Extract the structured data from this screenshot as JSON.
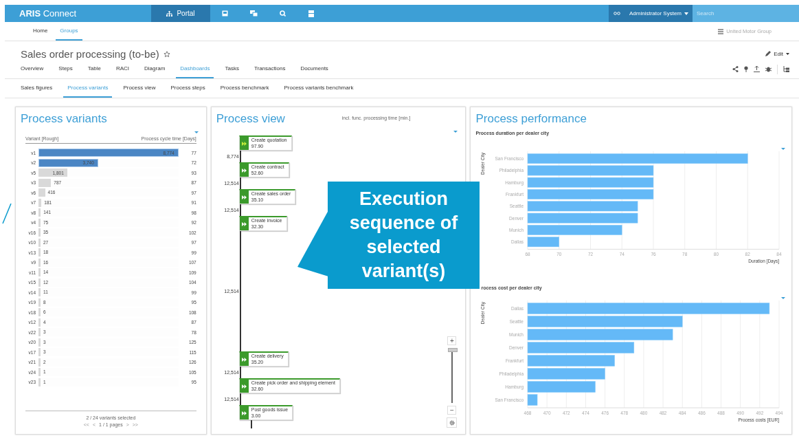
{
  "topbar": {
    "logo": "**ARIS** Connect",
    "portal": "Portal",
    "user": "Administrator System",
    "search": {
      "placeholder": "Search"
    }
  },
  "nav": {
    "items": [
      {
        "label": "Home",
        "selected": false
      },
      {
        "label": "Groups",
        "selected": true
      }
    ],
    "group": "United Motor Group"
  },
  "page": {
    "title": "Sales order processing (to-be)",
    "edit": "Edit"
  },
  "tabs": [
    {
      "label": "Overview",
      "selected": false
    },
    {
      "label": "Steps",
      "selected": false
    },
    {
      "label": "Table",
      "selected": false
    },
    {
      "label": "RACI",
      "selected": false
    },
    {
      "label": "Diagram",
      "selected": false
    },
    {
      "label": "Dashboards",
      "selected": true
    },
    {
      "label": "Tasks",
      "selected": false
    },
    {
      "label": "Transactions",
      "selected": false
    },
    {
      "label": "Documents",
      "selected": false
    }
  ],
  "subtabs": [
    {
      "label": "Sales figures",
      "selected": false
    },
    {
      "label": "Process variants",
      "selected": true
    },
    {
      "label": "Process view",
      "selected": false
    },
    {
      "label": "Process steps",
      "selected": false
    },
    {
      "label": "Process benchmark",
      "selected": false
    },
    {
      "label": "Process variants benchmark",
      "selected": false
    }
  ],
  "variants": {
    "title": "Process variants",
    "columns": [
      "Variant [Rough]",
      "Process cycle time [Days]"
    ],
    "rows": [
      {
        "name": "v1",
        "count": "8,774",
        "level": 1,
        "time": "77",
        "selected": true
      },
      {
        "name": "v2",
        "count": "3,740",
        "level": 0.426,
        "time": "72",
        "selected": true
      },
      {
        "name": "v5",
        "count": "1,801",
        "level": 0.205,
        "time": "93",
        "selected": false
      },
      {
        "name": "v3",
        "count": "787",
        "level": 0.09,
        "time": "87",
        "selected": false
      },
      {
        "name": "v6",
        "count": "416",
        "level": 0.047,
        "time": "97",
        "selected": false
      },
      {
        "name": "v7",
        "count": "181",
        "level": 0.021,
        "time": "91",
        "selected": false
      },
      {
        "name": "v8",
        "count": "141",
        "level": 0.016,
        "time": "98",
        "selected": false
      },
      {
        "name": "v4",
        "count": "75",
        "level": 0.009,
        "time": "92",
        "selected": false
      },
      {
        "name": "v16",
        "count": "35",
        "level": 0.004,
        "time": "102",
        "selected": false
      },
      {
        "name": "v10",
        "count": "27",
        "level": 0.003,
        "time": "97",
        "selected": false
      },
      {
        "name": "v13",
        "count": "18",
        "level": 0.002,
        "time": "99",
        "selected": false
      },
      {
        "name": "v9",
        "count": "16",
        "level": 0.002,
        "time": "107",
        "selected": false
      },
      {
        "name": "v11",
        "count": "14",
        "level": 0.002,
        "time": "109",
        "selected": false
      },
      {
        "name": "v15",
        "count": "12",
        "level": 0.001,
        "time": "104",
        "selected": false
      },
      {
        "name": "v14",
        "count": "11",
        "level": 0.001,
        "time": "99",
        "selected": false
      },
      {
        "name": "v19",
        "count": "8",
        "level": 0.001,
        "time": "95",
        "selected": false
      },
      {
        "name": "v18",
        "count": "6",
        "level": 0.001,
        "time": "108",
        "selected": false
      },
      {
        "name": "v12",
        "count": "4",
        "level": 0,
        "time": "87",
        "selected": false
      },
      {
        "name": "v22",
        "count": "3",
        "level": 0,
        "time": "78",
        "selected": false
      },
      {
        "name": "v20",
        "count": "3",
        "level": 0,
        "time": "125",
        "selected": false
      },
      {
        "name": "v17",
        "count": "3",
        "level": 0,
        "time": "115",
        "selected": false
      },
      {
        "name": "v21",
        "count": "2",
        "level": 0,
        "time": "126",
        "selected": false
      },
      {
        "name": "v24",
        "count": "1",
        "level": 0,
        "time": "105",
        "selected": false
      },
      {
        "name": "v23",
        "count": "1",
        "level": 0,
        "time": "95",
        "selected": false
      }
    ],
    "summary": "2 / 24 variants selected",
    "pager": {
      "first": "<<",
      "prev": "<",
      "label": "1 / 1 pages",
      "next": ">",
      "last": ">>"
    }
  },
  "process_view": {
    "title": "Process view",
    "subtitle": "incl. func. processing time [min.]",
    "steps": [
      {
        "name": "Create quotation",
        "time": "97.90",
        "flow": "8,774"
      },
      {
        "name": "Create contract",
        "time": "52.60",
        "flow": "12,514"
      },
      {
        "name": "Create sales order",
        "time": "35.10",
        "flow": "12,514"
      },
      {
        "name": "Create invoice",
        "time": "32.30",
        "flow": "12,514"
      },
      {
        "name": "Create delivery",
        "time": "35.20",
        "flow": "12,514"
      },
      {
        "name": "Create pick order and shipping element",
        "time": "32.60",
        "flow": "12,514"
      },
      {
        "name": "Post goods issue",
        "time": "3.00"
      }
    ],
    "zoom": {
      "in": "+",
      "out": "−",
      "level": 1
    }
  },
  "performance": {
    "title": "Process performance",
    "charts": [
      {
        "title": "Process duration per dealer city",
        "chart_data": {
          "type": "bar",
          "orientation": "horizontal",
          "xlabel": "Duration [Days]",
          "ylabel": "Dealer City",
          "categories": [
            "San Francisco",
            "Philadelphia",
            "Hamburg",
            "Frankfurt",
            "Seattle",
            "Denver",
            "Munich",
            "Dallas"
          ],
          "series": [
            {
              "color": "#64b9f7",
              "values": [
                82,
                76,
                76,
                76,
                75,
                75,
                74,
                70
              ]
            }
          ],
          "grid": true,
          "xlim": [
            68,
            84
          ],
          "xticks": [
            68,
            70,
            72,
            74,
            76,
            78,
            80,
            82,
            84
          ]
        }
      },
      {
        "title": "rocess cost per dealer city",
        "chart_data": {
          "type": "bar",
          "orientation": "horizontal",
          "xlabel": "Process costs [EUR]",
          "ylabel": "Dealer City",
          "categories": [
            "Dallas",
            "Seattle",
            "Munich",
            "Denver",
            "Frankfurt",
            "Philadelphia",
            "Hamburg",
            "San Francisco"
          ],
          "series": [
            {
              "color": "#64b9f7",
              "values": [
                493,
                484,
                483,
                479,
                477,
                476,
                475,
                469
              ]
            }
          ],
          "grid": true,
          "xlim": [
            468,
            494
          ],
          "xticks": [
            468,
            470,
            472,
            474,
            476,
            478,
            480,
            482,
            484,
            486,
            488,
            490,
            492,
            494
          ]
        }
      }
    ]
  },
  "callout": {
    "text": "Execution sequence of selected variant(s)"
  }
}
